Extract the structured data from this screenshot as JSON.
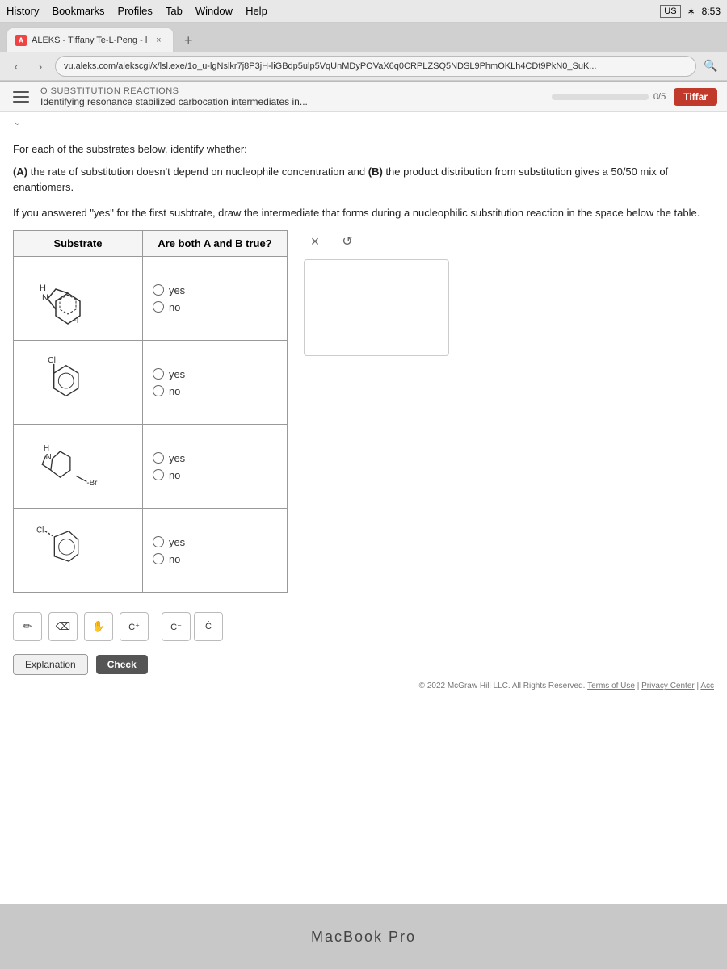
{
  "macbook": {
    "label": "MacBook Pro"
  },
  "menubar": {
    "items": [
      "History",
      "Bookmarks",
      "Profiles",
      "Tab",
      "Window",
      "Help"
    ],
    "right": {
      "country": "US",
      "time": "8:53"
    }
  },
  "browser": {
    "tab": {
      "favicon": "A",
      "title": "ALEKS - Tiffany Te-L-Peng - l",
      "close": "×"
    },
    "new_tab": "+",
    "address": "vu.aleks.com/alekscgi/x/lsl.exe/1o_u-lgNslkr7j8P3jH-liGBdp5ulp5VqUnMDyPOVaX6q0CRPLZSQ5NDSL9PhmOKLh4CDt9PkN0_SuK...",
    "search_icon": "🔍"
  },
  "aleks": {
    "section": "O SUBSTITUTION REACTIONS",
    "subtitle": "Identifying resonance stabilized carbocation intermediates in...",
    "progress": "0/5",
    "progress_pct": 0,
    "user_btn": "Tiffar"
  },
  "question": {
    "intro": "For each of the substrates below, identify whether:",
    "part_a_label": "(A)",
    "part_a": "the rate of substitution doesn't depend on nucleophile concentration and",
    "part_b_label": "(B)",
    "part_b": "the product distribution from substitution gives a 50/50 mix of enantiomers.",
    "instruction": "If you answered \"yes\" for the first susbtrate, draw the intermediate that forms during a nucleophilic substitution reaction in the space below the table.",
    "table": {
      "col1": "Substrate",
      "col2": "Are both A and B true?",
      "rows": [
        {
          "id": 1,
          "label": "substrate-1",
          "options": [
            "yes",
            "no"
          ]
        },
        {
          "id": 2,
          "label": "substrate-2",
          "options": [
            "yes",
            "no"
          ]
        },
        {
          "id": 3,
          "label": "substrate-3",
          "options": [
            "yes",
            "no"
          ]
        },
        {
          "id": 4,
          "label": "substrate-4",
          "options": [
            "yes",
            "no"
          ]
        }
      ]
    }
  },
  "controls": {
    "cross": "×",
    "undo": "↺",
    "chem_tools": [
      {
        "id": "pencil",
        "symbol": "✏"
      },
      {
        "id": "eraser",
        "symbol": "⌫"
      },
      {
        "id": "hand",
        "symbol": "✋"
      },
      {
        "id": "cplus",
        "symbol": "C⁺"
      },
      {
        "id": "cminus",
        "symbol": "C⁻"
      },
      {
        "id": "cdot",
        "symbol": "Ċ"
      }
    ]
  },
  "footer": {
    "explanation_label": "Explanation",
    "check_label": "Check",
    "copyright": "© 2022 McGraw Hill LLC. All Rights Reserved.",
    "terms": "Terms of Use",
    "privacy": "Privacy Center",
    "acc": "Acc"
  }
}
